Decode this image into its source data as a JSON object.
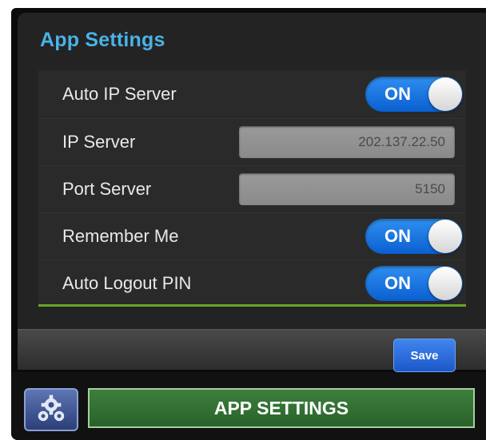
{
  "panel": {
    "title": "App Settings"
  },
  "settings": {
    "auto_ip_server": {
      "label": "Auto IP Server",
      "toggle": "ON"
    },
    "ip_server": {
      "label": "IP Server",
      "value": "202.137.22.50"
    },
    "port_server": {
      "label": "Port Server",
      "value": "5150"
    },
    "remember_me": {
      "label": "Remember Me",
      "toggle": "ON"
    },
    "auto_logout_pin": {
      "label": "Auto Logout PIN",
      "toggle": "ON"
    }
  },
  "actions": {
    "save_label": "Save"
  },
  "footer": {
    "title": "APP SETTINGS",
    "icon": "gear-cog-icon"
  },
  "colors": {
    "accent_title": "#4ab2e6",
    "toggle_on": "#1e74e0",
    "divider_green": "#6aa629",
    "footer_bar": "#3d7f3d"
  }
}
